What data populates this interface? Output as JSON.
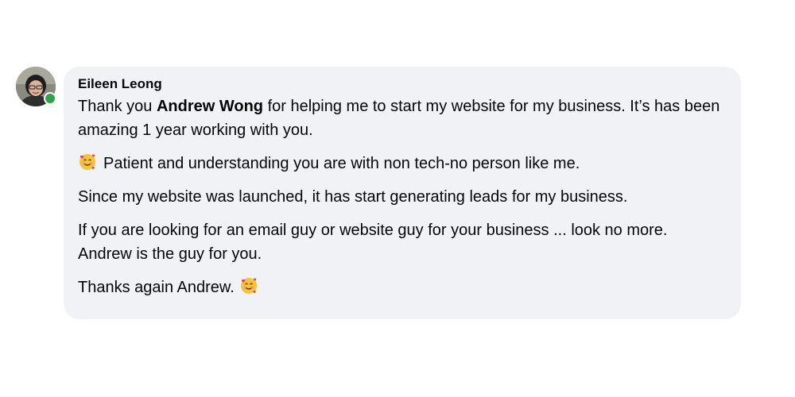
{
  "comment": {
    "author": "Eileen Leong",
    "online": true,
    "presence_color": "#31a24c",
    "bubble_color": "#f0f2f5",
    "line1_before": "Thank you ",
    "mention": "Andrew Wong",
    "line1_after": " for helping me to start my website for my business. It’s has been amazing 1 year working with you.",
    "emoji": "smiling-face-with-hearts",
    "line2": "Patient and understanding you are with non tech-no person like me.",
    "line3": "Since my website was launched, it has start generating leads for my business.",
    "line4": "If you are looking for an email guy or website guy for your business ... look no more.",
    "line5": "Andrew is the guy for you.",
    "line6": "Thanks again Andrew."
  }
}
